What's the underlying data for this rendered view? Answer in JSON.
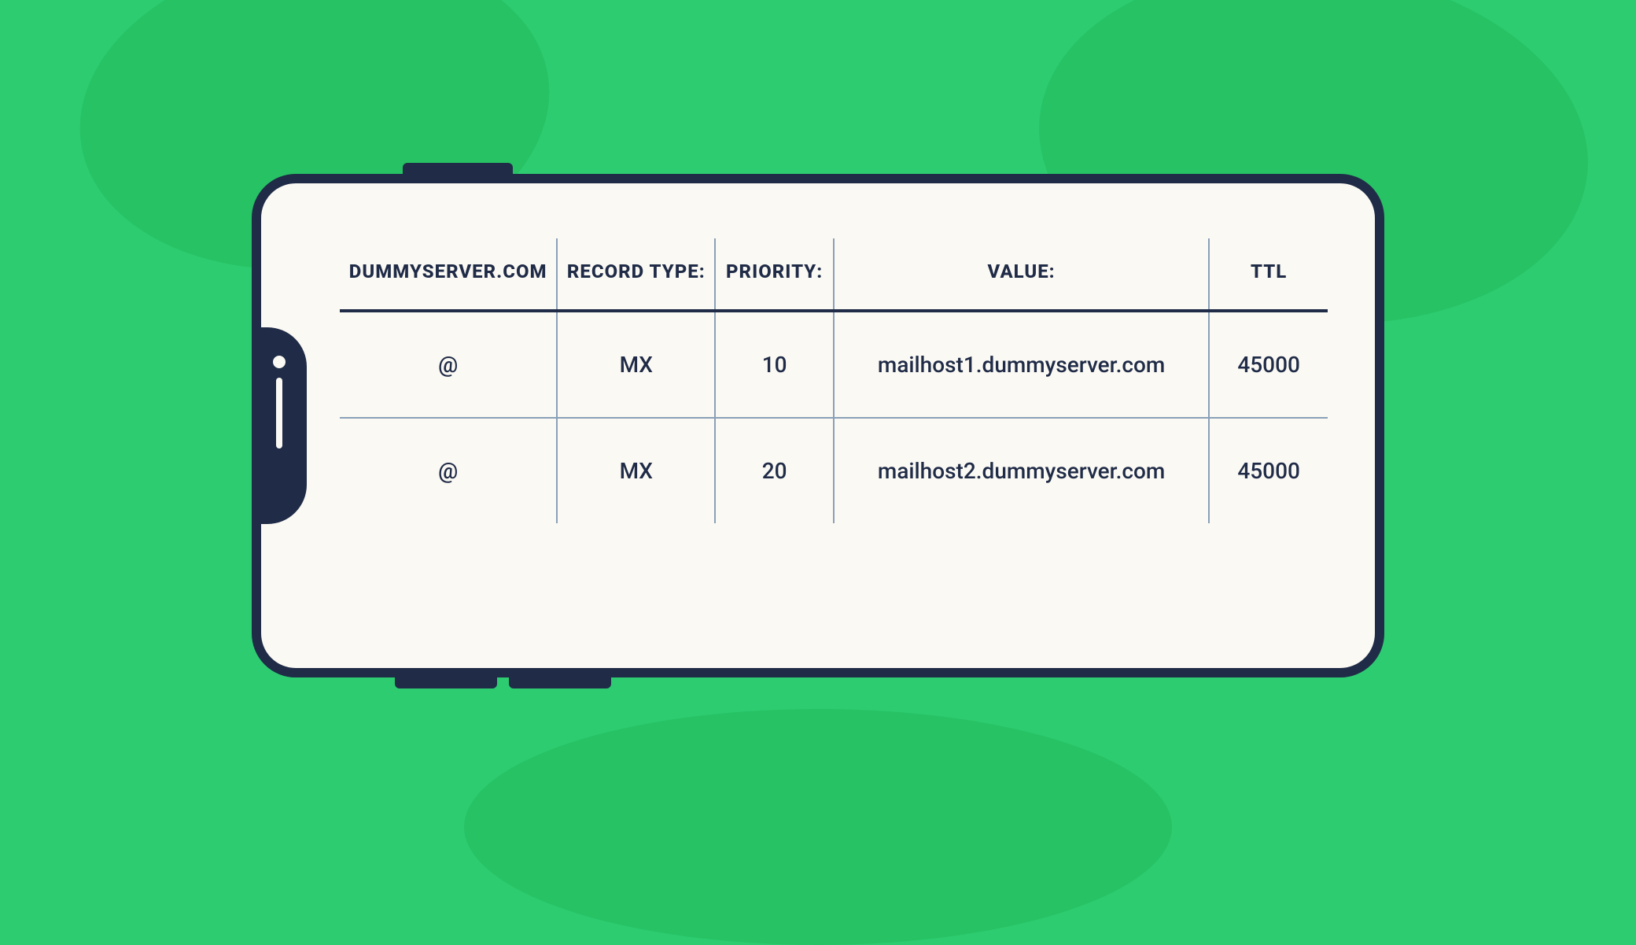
{
  "table": {
    "headers": {
      "domain": "DUMMYSERVER.COM",
      "record_type": "RECORD TYPE:",
      "priority": "PRIORITY:",
      "value": "VALUE:",
      "ttl": "TTL"
    },
    "rows": [
      {
        "domain": "@",
        "record_type": "MX",
        "priority": "10",
        "value": "mailhost1.dummyserver.com",
        "ttl": "45000"
      },
      {
        "domain": "@",
        "record_type": "MX",
        "priority": "20",
        "value": "mailhost2.dummyserver.com",
        "ttl": "45000"
      }
    ]
  }
}
